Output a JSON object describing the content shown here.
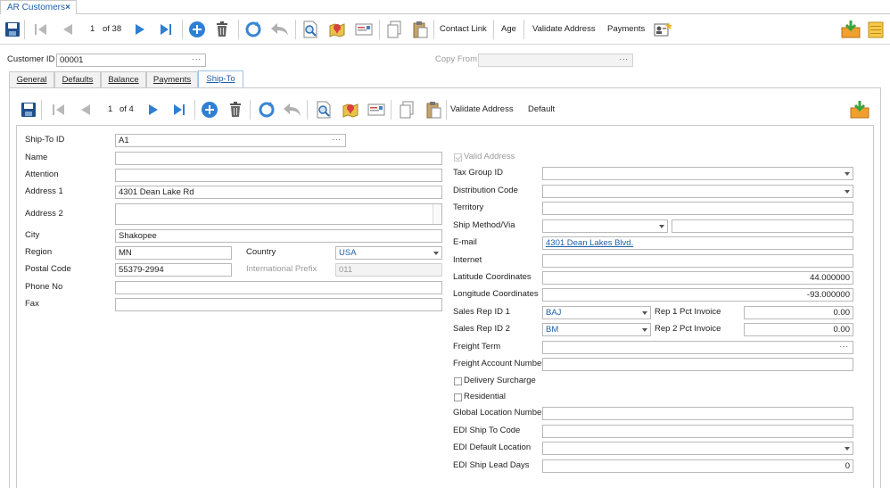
{
  "window": {
    "tab_title": "AR Customers",
    "close_glyph": "×"
  },
  "main_toolbar": {
    "record_index": "1",
    "record_of": "of 38",
    "buttons": [
      "Contact Link",
      "Age",
      "Validate Address",
      "Payments"
    ]
  },
  "header": {
    "customer_id_label": "Customer ID",
    "customer_id_value": "00001",
    "copy_from_label": "Copy From",
    "copy_from_value": ""
  },
  "tabs": [
    "General",
    "Defaults",
    "Balance",
    "Payments",
    "Ship-To"
  ],
  "active_tab": "Ship-To",
  "shipto_toolbar": {
    "record_index": "1",
    "record_of": "of 4",
    "buttons": [
      "Validate Address",
      "Default"
    ]
  },
  "left_form": {
    "ship_to_id": {
      "label": "Ship-To ID",
      "value": "A1"
    },
    "name": {
      "label": "Name",
      "value": ""
    },
    "attention": {
      "label": "Attention",
      "value": ""
    },
    "address1": {
      "label": "Address 1",
      "value": "4301 Dean Lake Rd"
    },
    "address2": {
      "label": "Address 2",
      "value": ""
    },
    "city": {
      "label": "City",
      "value": "Shakopee"
    },
    "region": {
      "label": "Region",
      "value": "MN"
    },
    "country": {
      "label": "Country",
      "value": "USA"
    },
    "postal_code": {
      "label": "Postal Code",
      "value": "55379-2994"
    },
    "intl_prefix": {
      "label": "International Prefix",
      "value": "011"
    },
    "phone": {
      "label": "Phone No",
      "value": ""
    },
    "fax": {
      "label": "Fax",
      "value": ""
    }
  },
  "right_form": {
    "valid_address": {
      "label": "Valid Address",
      "checked": true
    },
    "tax_group": {
      "label": "Tax Group ID",
      "value": ""
    },
    "distribution_code": {
      "label": "Distribution Code",
      "value": ""
    },
    "territory": {
      "label": "Territory",
      "value": ""
    },
    "ship_method": {
      "label": "Ship Method/Via",
      "value": "",
      "value2": ""
    },
    "email": {
      "label": "E-mail",
      "value": "4301 Dean Lakes Blvd."
    },
    "internet": {
      "label": "Internet",
      "value": ""
    },
    "latitude": {
      "label": "Latitude Coordinates",
      "value": "44.000000"
    },
    "longitude": {
      "label": "Longitude Coordinates",
      "value": "-93.000000"
    },
    "sales_rep1": {
      "label": "Sales Rep ID 1",
      "value": "BAJ",
      "pct_label": "Rep 1 Pct Invoice",
      "pct": "0.00"
    },
    "sales_rep2": {
      "label": "Sales Rep ID 2",
      "value": "BM",
      "pct_label": "Rep 2 Pct Invoice",
      "pct": "0.00"
    },
    "freight_term": {
      "label": "Freight Term",
      "value": ""
    },
    "freight_account": {
      "label": "Freight Account Number",
      "value": ""
    },
    "delivery_surcharge": {
      "label": "Delivery Surcharge",
      "checked": false
    },
    "residential": {
      "label": "Residential",
      "checked": false
    },
    "gln": {
      "label": "Global Location Number",
      "value": ""
    },
    "edi_ship_to": {
      "label": "EDI Ship To Code",
      "value": ""
    },
    "edi_default_location": {
      "label": "EDI Default Location",
      "value": ""
    },
    "edi_lead_days": {
      "label": "EDI Ship Lead Days",
      "value": "0"
    }
  },
  "colors": {
    "accent": "#1f5fa8",
    "tab_border": "#9fc3e9",
    "save_icon": "#1f4f8a",
    "nav_arrow": "#2f7fd3"
  }
}
